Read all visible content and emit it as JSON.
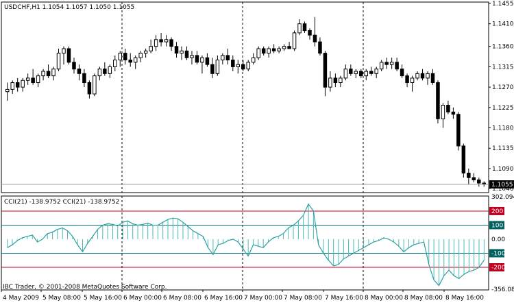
{
  "chart_data": [
    {
      "type": "candlestick",
      "title": "USDCHF,H1  1.1054 1.1057 1.1050 1.1055",
      "price_axis_ticks": [
        "1.1455",
        "1.1410",
        "1.1360",
        "1.1315",
        "1.1270",
        "1.1225",
        "1.1180",
        "1.1135",
        "1.1090",
        "1.1046"
      ],
      "ylim": [
        1.1046,
        1.1455
      ],
      "current_price_label": "1.1055",
      "current_price": 1.1055,
      "grid": "vertical-dashed",
      "candles": [
        [
          1.126,
          1.128,
          1.124,
          1.1265
        ],
        [
          1.1265,
          1.1285,
          1.1255,
          1.128
        ],
        [
          1.128,
          1.129,
          1.126,
          1.127
        ],
        [
          1.127,
          1.129,
          1.126,
          1.1285
        ],
        [
          1.1285,
          1.13,
          1.1275,
          1.129
        ],
        [
          1.129,
          1.131,
          1.1275,
          1.128
        ],
        [
          1.128,
          1.13,
          1.127,
          1.1295
        ],
        [
          1.1295,
          1.131,
          1.1285,
          1.1305
        ],
        [
          1.1305,
          1.132,
          1.129,
          1.1295
        ],
        [
          1.1295,
          1.1315,
          1.1285,
          1.131
        ],
        [
          1.131,
          1.1355,
          1.1305,
          1.1345
        ],
        [
          1.1345,
          1.136,
          1.132,
          1.1355
        ],
        [
          1.1355,
          1.136,
          1.132,
          1.1325
        ],
        [
          1.1325,
          1.1335,
          1.13,
          1.131
        ],
        [
          1.131,
          1.132,
          1.1285,
          1.13
        ],
        [
          1.13,
          1.131,
          1.127,
          1.128
        ],
        [
          1.128,
          1.1285,
          1.1245,
          1.1255
        ],
        [
          1.1255,
          1.13,
          1.125,
          1.1295
        ],
        [
          1.1295,
          1.1315,
          1.1285,
          1.131
        ],
        [
          1.131,
          1.1325,
          1.1295,
          1.13
        ],
        [
          1.13,
          1.132,
          1.129,
          1.1315
        ],
        [
          1.1315,
          1.134,
          1.1305,
          1.133
        ],
        [
          1.133,
          1.135,
          1.1315,
          1.1345
        ],
        [
          1.1345,
          1.1355,
          1.132,
          1.133
        ],
        [
          1.133,
          1.1345,
          1.1315,
          1.1325
        ],
        [
          1.1325,
          1.134,
          1.131,
          1.1335
        ],
        [
          1.1335,
          1.135,
          1.1325,
          1.1345
        ],
        [
          1.1345,
          1.1355,
          1.1335,
          1.135
        ],
        [
          1.135,
          1.1375,
          1.1345,
          1.136
        ],
        [
          1.136,
          1.1385,
          1.135,
          1.1375
        ],
        [
          1.1375,
          1.139,
          1.136,
          1.137
        ],
        [
          1.137,
          1.1385,
          1.136,
          1.1375
        ],
        [
          1.1375,
          1.138,
          1.135,
          1.136
        ],
        [
          1.136,
          1.137,
          1.1335,
          1.1345
        ],
        [
          1.1345,
          1.136,
          1.133,
          1.135
        ],
        [
          1.135,
          1.136,
          1.133,
          1.1335
        ],
        [
          1.1335,
          1.135,
          1.132,
          1.134
        ],
        [
          1.134,
          1.135,
          1.132,
          1.1325
        ],
        [
          1.1325,
          1.134,
          1.13,
          1.1335
        ],
        [
          1.1335,
          1.1345,
          1.1315,
          1.132
        ],
        [
          1.132,
          1.1335,
          1.129,
          1.13
        ],
        [
          1.13,
          1.134,
          1.1295,
          1.133
        ],
        [
          1.133,
          1.1345,
          1.132,
          1.134
        ],
        [
          1.134,
          1.1355,
          1.132,
          1.133
        ],
        [
          1.133,
          1.134,
          1.1305,
          1.1315
        ],
        [
          1.1315,
          1.133,
          1.13,
          1.132
        ],
        [
          1.132,
          1.133,
          1.1305,
          1.131
        ],
        [
          1.131,
          1.133,
          1.1305,
          1.1325
        ],
        [
          1.1325,
          1.1345,
          1.132,
          1.1335
        ],
        [
          1.1335,
          1.136,
          1.133,
          1.1355
        ],
        [
          1.1355,
          1.136,
          1.134,
          1.1345
        ],
        [
          1.1345,
          1.136,
          1.1335,
          1.1355
        ],
        [
          1.1355,
          1.1365,
          1.1345,
          1.135
        ],
        [
          1.135,
          1.136,
          1.1345,
          1.1355
        ],
        [
          1.1355,
          1.1365,
          1.135,
          1.136
        ],
        [
          1.136,
          1.137,
          1.1355,
          1.1355
        ],
        [
          1.1355,
          1.1395,
          1.135,
          1.139
        ],
        [
          1.139,
          1.142,
          1.1385,
          1.141
        ],
        [
          1.141,
          1.1415,
          1.139,
          1.1395
        ],
        [
          1.1395,
          1.14,
          1.1375,
          1.1385
        ],
        [
          1.1385,
          1.1425,
          1.136,
          1.137
        ],
        [
          1.137,
          1.138,
          1.134,
          1.1345
        ],
        [
          1.1345,
          1.135,
          1.125,
          1.127
        ],
        [
          1.127,
          1.1305,
          1.126,
          1.129
        ],
        [
          1.129,
          1.13,
          1.127,
          1.128
        ],
        [
          1.128,
          1.1295,
          1.127,
          1.129
        ],
        [
          1.129,
          1.132,
          1.1285,
          1.131
        ],
        [
          1.131,
          1.132,
          1.1295,
          1.13
        ],
        [
          1.13,
          1.131,
          1.129,
          1.1305
        ],
        [
          1.1305,
          1.131,
          1.129,
          1.1295
        ],
        [
          1.1295,
          1.131,
          1.1285,
          1.1305
        ],
        [
          1.1305,
          1.1315,
          1.1295,
          1.13
        ],
        [
          1.13,
          1.1315,
          1.129,
          1.131
        ],
        [
          1.131,
          1.133,
          1.1305,
          1.1325
        ],
        [
          1.1325,
          1.1335,
          1.131,
          1.132
        ],
        [
          1.132,
          1.1335,
          1.131,
          1.1325
        ],
        [
          1.1325,
          1.1335,
          1.1305,
          1.131
        ],
        [
          1.131,
          1.132,
          1.129,
          1.1295
        ],
        [
          1.1295,
          1.13,
          1.127,
          1.128
        ],
        [
          1.128,
          1.1295,
          1.126,
          1.129
        ],
        [
          1.129,
          1.1305,
          1.1285,
          1.13
        ],
        [
          1.13,
          1.131,
          1.1285,
          1.129
        ],
        [
          1.129,
          1.1305,
          1.1275,
          1.13
        ],
        [
          1.13,
          1.131,
          1.1275,
          1.128
        ],
        [
          1.128,
          1.1285,
          1.119,
          1.12
        ],
        [
          1.12,
          1.1235,
          1.118,
          1.123
        ],
        [
          1.123,
          1.124,
          1.121,
          1.1215
        ],
        [
          1.1215,
          1.1225,
          1.12,
          1.121
        ],
        [
          1.121,
          1.1215,
          1.113,
          1.114
        ],
        [
          1.114,
          1.1145,
          1.107,
          1.108
        ],
        [
          1.108,
          1.109,
          1.1055,
          1.107
        ],
        [
          1.107,
          1.108,
          1.106,
          1.1065
        ],
        [
          1.1065,
          1.107,
          1.105,
          1.1058
        ],
        [
          1.1058,
          1.1062,
          1.105,
          1.1055
        ]
      ]
    },
    {
      "type": "line",
      "indicator_label": "CCI(21) -138.9752  CCI(21) -138.9752",
      "ylim": [
        -356.083,
        302.0948
      ],
      "y_axis_ticks": [
        "302.0948",
        "200",
        "100",
        "0.00",
        "-100",
        "-200",
        "-356.083"
      ],
      "levels": [
        200,
        100,
        -100,
        -200
      ],
      "level_labels": [
        "200",
        "100",
        "-100",
        "-200"
      ],
      "histogram": true,
      "series": [
        {
          "values": [
            -60,
            -40,
            -10,
            10,
            20,
            30,
            -20,
            0,
            40,
            50,
            70,
            80,
            60,
            20,
            -40,
            -90,
            -30,
            20,
            70,
            100,
            110,
            105,
            95,
            120,
            130,
            110,
            100,
            105,
            115,
            100,
            100,
            120,
            140,
            150,
            145,
            120,
            90,
            60,
            40,
            20,
            -60,
            -110,
            -40,
            -30,
            -10,
            0,
            -20,
            -70,
            -120,
            -40,
            -50,
            -60,
            -20,
            10,
            20,
            40,
            80,
            100,
            130,
            170,
            250,
            200,
            -40,
            -100,
            -150,
            -190,
            -180,
            -140,
            -120,
            -100,
            -80,
            -60,
            -40,
            -20,
            -10,
            10,
            0,
            -20,
            -50,
            -90,
            -60,
            -40,
            -30,
            -20,
            -180,
            -290,
            -330,
            -260,
            -220,
            -260,
            -280,
            -250,
            -230,
            -220,
            -200,
            -150
          ]
        }
      ]
    }
  ],
  "x_axis": {
    "labels": [
      "4 May 2009",
      "5 May 08:00",
      "5 May 16:00",
      "6 May 00:00",
      "6 May 08:00",
      "6 May 16:00",
      "7 May 00:00",
      "7 May 08:00",
      "7 May 16:00",
      "8 May 00:00",
      "8 May 08:00",
      "8 May 16:00"
    ]
  },
  "copyright": "IBC Trader, © 2001-2008 MetaQuotes Software Corp.",
  "colors": {
    "price_label_bg": "#000000",
    "level_200": "#c00020",
    "level_100": "#007070",
    "level_200_label_bg": "#c00020",
    "level_100_label_bg": "#006060",
    "cci_line": "#2aa0a0",
    "histogram": "#4ab8b8"
  }
}
